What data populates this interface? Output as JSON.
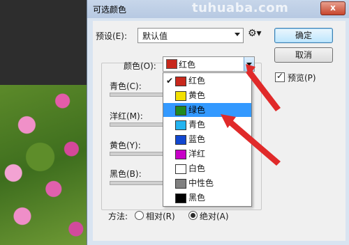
{
  "dialog": {
    "title": "可选颜色",
    "watermark": "tuhuaba.com",
    "close_label": "x"
  },
  "preset": {
    "label": "预设(E):",
    "value": "默认值"
  },
  "buttons": {
    "ok": "确定",
    "cancel": "取消"
  },
  "preview": {
    "label": "预览(P)",
    "checked": true
  },
  "colors": {
    "label": "颜色(O):",
    "selected": "红色",
    "selected_color": "#c8281c"
  },
  "sliders": [
    {
      "label": "青色(C):"
    },
    {
      "label": "洋红(M):"
    },
    {
      "label": "黄色(Y):"
    },
    {
      "label": "黑色(B):"
    }
  ],
  "dropdown": {
    "options": [
      {
        "label": "红色",
        "color": "#c8281c",
        "checked": true
      },
      {
        "label": "黄色",
        "color": "#f2e000"
      },
      {
        "label": "绿色",
        "color": "#1f8a1f",
        "highlight": true
      },
      {
        "label": "青色",
        "color": "#24b4f0"
      },
      {
        "label": "蓝色",
        "color": "#1247d0"
      },
      {
        "label": "洋红",
        "color": "#c800c8"
      },
      {
        "label": "白色",
        "color": "#ffffff"
      },
      {
        "label": "中性色",
        "color": "#808080"
      },
      {
        "label": "黑色",
        "color": "#000000"
      }
    ]
  },
  "method": {
    "label": "方法:",
    "relative": "相对(R)",
    "absolute": "绝对(A)",
    "selected": "absolute"
  }
}
